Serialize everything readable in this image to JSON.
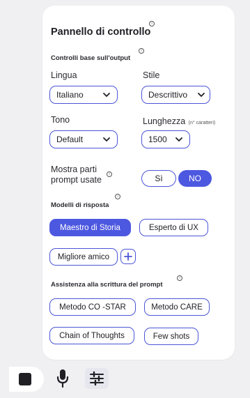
{
  "panel": {
    "title": "Pannello di controllo",
    "sections": {
      "base": "Controlli base sull'output",
      "models": "Modelli di risposta",
      "writing": "Assistenza alla scrittura del prompt"
    }
  },
  "fields": {
    "lingua": {
      "label": "Lingua",
      "value": "Italiano"
    },
    "stile": {
      "label": "Stile",
      "value": "Descrittivo"
    },
    "tono": {
      "label": "Tono",
      "value": "Default"
    },
    "lunghezza": {
      "label": "Lunghezza",
      "hint": "(n° caratteri)",
      "value": "1500"
    }
  },
  "toggle": {
    "label_line1": "Mostra parti",
    "label_line2": "prompt usate",
    "yes": "Sì",
    "no": "NO",
    "selected": "NO"
  },
  "models": {
    "items": [
      "Maestro di Storia",
      "Esperto di UX",
      "Migliore amico"
    ],
    "selected": "Maestro di Storia",
    "add_label": "+"
  },
  "writing": {
    "items": [
      "Metodo CO -STAR",
      "Metodo CARE",
      "Chain of Thoughts",
      "Few shots"
    ]
  },
  "icons": {
    "info": "info-icon",
    "chevron": "chevron-down-icon",
    "stop": "stop-icon",
    "mic": "microphone-icon",
    "settings": "sliders-icon"
  },
  "colors": {
    "accent": "#4d58e0",
    "background": "#f0f0f3",
    "panel": "#ffffff"
  }
}
